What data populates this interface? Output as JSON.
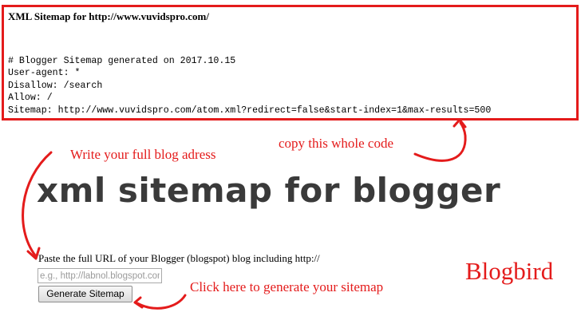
{
  "code_box": {
    "title": "XML Sitemap for http://www.vuvidspro.com/",
    "lines": [
      "# Blogger Sitemap generated on 2017.10.15",
      "User-agent: *",
      "Disallow: /search",
      "Allow: /",
      "Sitemap: http://www.vuvidspro.com/atom.xml?redirect=false&start-index=1&max-results=500"
    ]
  },
  "annotations": {
    "copy": "copy this whole code",
    "write": "Write your full blog adress",
    "click": "Click here to generate your sitemap"
  },
  "main_title": "xml sitemap for blogger",
  "form": {
    "label": "Paste the full URL of your Blogger (blogspot) blog including http://",
    "input_value": "",
    "input_placeholder": "e.g., http://labnol.blogspot.com",
    "button_label": "Generate Sitemap"
  },
  "brand": "Blogbird",
  "colors": {
    "annotation_red": "#e41b1b",
    "title_gray": "#3a3a3a"
  },
  "icons": [
    "curved-arrow-icon"
  ]
}
